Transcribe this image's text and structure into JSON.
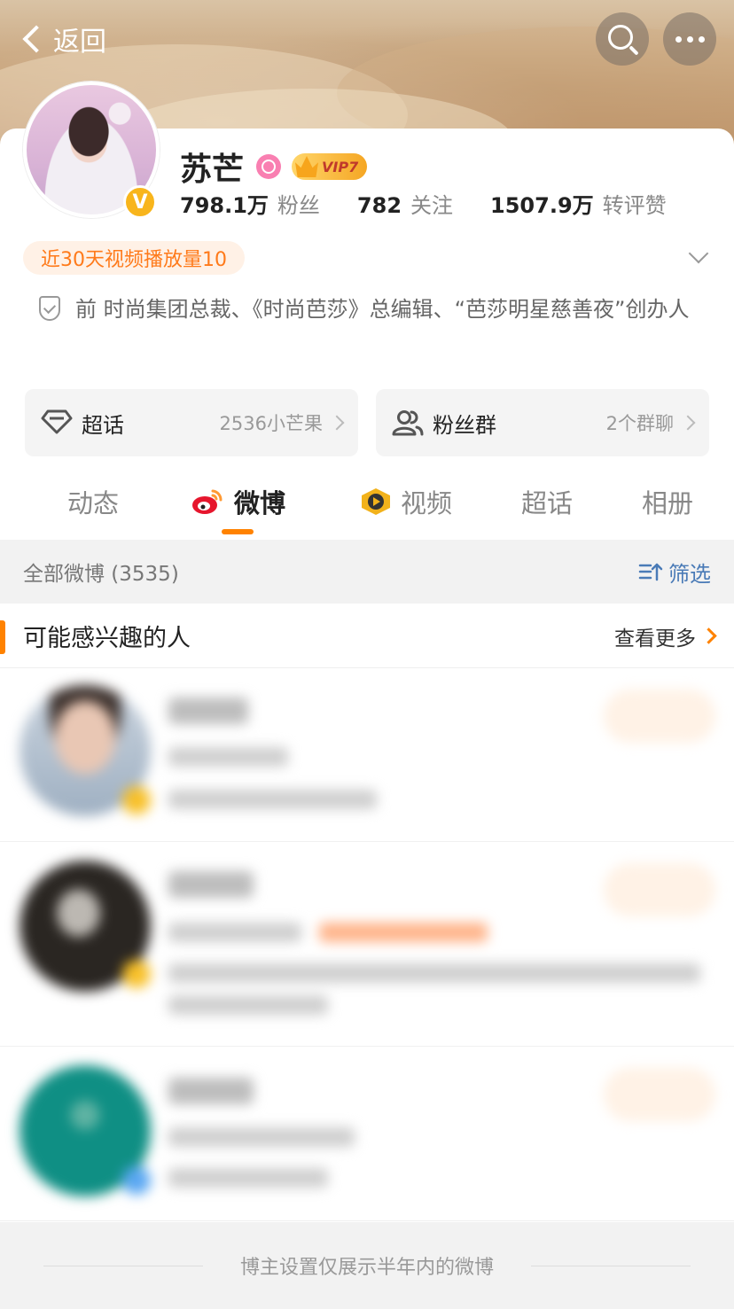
{
  "header": {
    "back_label": "返回",
    "icons": {
      "back": "chevron-left-icon",
      "search": "search-icon",
      "more": "more-dots-icon"
    }
  },
  "profile": {
    "name": "苏芒",
    "vip_label": "VIP7",
    "verified_badge": "V",
    "stats": [
      {
        "value": "798.1万",
        "label": "粉丝"
      },
      {
        "value": "782",
        "label": "关注"
      },
      {
        "value": "1507.9万",
        "label": "转评赞"
      }
    ],
    "tag": "近30天视频播放量10",
    "description": "前 时尚集团总裁、《时尚芭莎》总编辑、“芭莎明星慈善夜”创办人"
  },
  "features": [
    {
      "title": "超话",
      "sub": "2536小芒果"
    },
    {
      "title": "粉丝群",
      "sub": "2个群聊"
    }
  ],
  "tabs": [
    "动态",
    "微博",
    "视频",
    "超话",
    "相册"
  ],
  "active_tab": "微博",
  "filter": {
    "count_label": "全部微博 (3535)",
    "filter_label": "筛选"
  },
  "recommend": {
    "title": "可能感兴趣的人",
    "more_label": "查看更多"
  },
  "footer": {
    "notice": "博主设置仅展示半年内的微博"
  },
  "colors": {
    "accent": "#ff8200",
    "link": "#4a7bb7",
    "verified": "#f8b51c",
    "gender_female": "#f97fb1"
  }
}
